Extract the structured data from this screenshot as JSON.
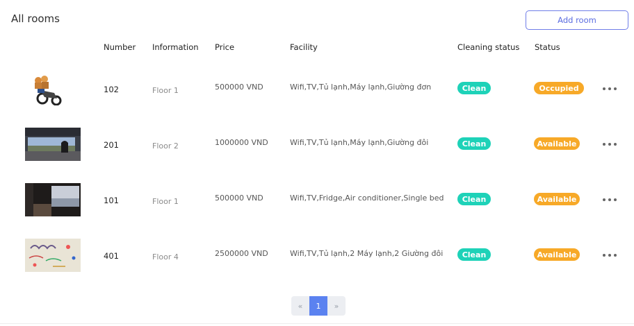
{
  "page_title": "All rooms",
  "add_button": "Add room",
  "headers": {
    "number": "Number",
    "information": "Information",
    "price": "Price",
    "facility": "Facility",
    "cleaning_status": "Cleaning status",
    "status": "Status"
  },
  "rooms": [
    {
      "number": "102",
      "information": "Floor 1",
      "price": "500000 VND",
      "facility": "Wifi,TV,Tủ lạnh,Máy lạnh,Giường đơn",
      "cleaning": "Clean",
      "status": "Occupied",
      "image": "motorbike-photo"
    },
    {
      "number": "201",
      "information": "Floor 2",
      "price": "1000000 VND",
      "facility": "Wifi,TV,Tủ lạnh,Máy lạnh,Giường đôi",
      "cleaning": "Clean",
      "status": "Available",
      "image": "window-view-photo"
    },
    {
      "number": "101",
      "information": "Floor 1",
      "price": "500000 VND",
      "facility": "Wifi,TV,Fridge,Air conditioner,Single bed",
      "cleaning": "Clean",
      "status": "Available",
      "image": "room-window-photo"
    },
    {
      "number": "401",
      "information": "Floor 4",
      "price": "2500000 VND",
      "facility": "Wifi,TV,Tủ lạnh,2 Máy lạnh,2 Giường đôi",
      "cleaning": "Clean",
      "status": "Available",
      "image": "drawing-photo"
    }
  ],
  "pagination": {
    "prev": "«",
    "current": "1",
    "next": "»"
  },
  "colors": {
    "clean": "#1ed2b8",
    "status": "#f7a928",
    "accent": "#5b82f0"
  },
  "icons": {
    "row_menu": "more-horizontal-icon"
  }
}
